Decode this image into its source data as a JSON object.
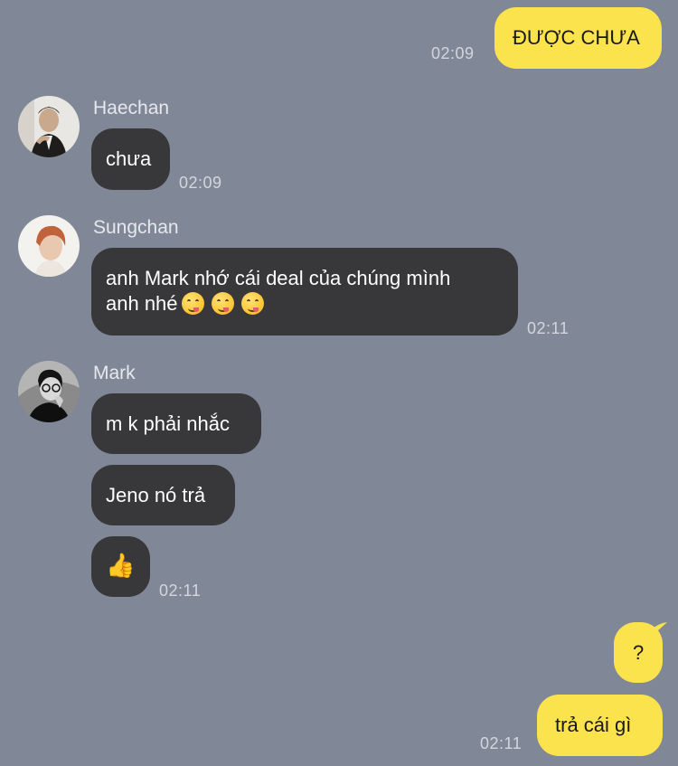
{
  "messages": {
    "m1": {
      "text": "ĐƯỢC CHƯA",
      "time": "02:09"
    },
    "haechan": {
      "name": "Haechan",
      "text": "chưa",
      "time": "02:09"
    },
    "sungchan": {
      "name": "Sungchan",
      "line1": "anh Mark nhớ cái deal của chúng mình",
      "line2": "anh nhé",
      "time": "02:11",
      "emoji": "yum-face-icon"
    },
    "mark": {
      "name": "Mark",
      "text1": "m k phải nhắc",
      "text2": "Jeno nó trả",
      "emoji": "👍",
      "time": "02:11"
    },
    "m_q": {
      "text": "?"
    },
    "m_last": {
      "text": "trả cái gì",
      "time": "02:11"
    }
  },
  "colors": {
    "background": "#808897",
    "my_bubble": "#fae34c",
    "their_bubble": "#38383b"
  }
}
